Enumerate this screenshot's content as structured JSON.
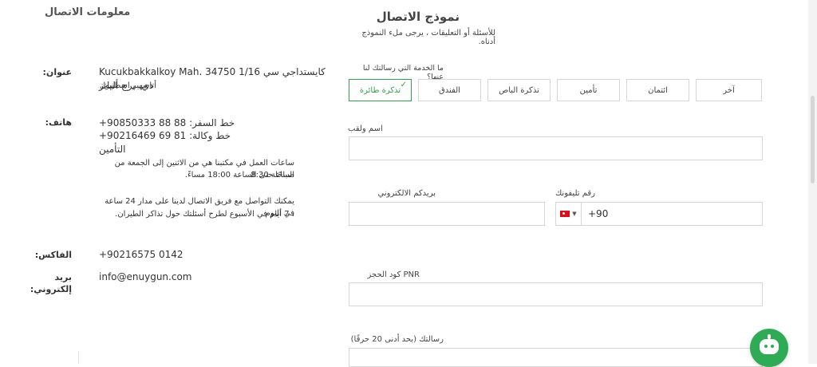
{
  "contact_info": {
    "title": "معلومات الاتصال",
    "address_label": "عنوان:",
    "address_line1": "Kucukbakkalkoy Mah. 34750 1/16 كايستداجي سي دي. برج أليانز",
    "address_line2": "أتاسهير اسطنبول",
    "phone_label": "هاتف:",
    "phone_line1": "+90850333 88 88   :خط السفر",
    "phone_line2": "+90216469 69 81   :خط وكالة التأمين",
    "hours_line1": "ساعات العمل في مكتبنا هي من الاثنين إلى الجمعة من الساعة 8:30",
    "hours_line2": "صباحًا حتى الساعة 18:00 مساءً.",
    "reach_line1": "يمكنك التواصل مع فريق الاتصال لدينا على مدار 24 ساعة في اليوم",
    "reach_line2": "، 7 أيام في الأسبوع لطرح أسئلتك حول تذاكر الطيران.",
    "fax_label": "الفاكس:",
    "fax_value": "+90216575 0142",
    "email_label_1": "بريد",
    "email_label_2": "إلكتروني:",
    "email_value": "info@enuygun.com"
  },
  "form": {
    "title": "نموذج الاتصال",
    "subtitle": "للأسئلة أو التعليقات ، يرجى ملء النموذج أدناه.",
    "service_question": "ما الخدمة التي رسالتك لنا عنها؟",
    "service_options": [
      "تذكرة طائرة",
      "الفندق",
      "تذكرة الباص",
      "تأمين",
      "ائتمان",
      "آخر"
    ],
    "selected_option": "تذكرة طائرة",
    "name_label": "اسم ولقب",
    "email_label": "بريدكم الالكتروني",
    "phone_label": "رقم تليفونك",
    "phone_code": "+90",
    "pnr_label": "PNR كود الحجز",
    "message_label": "رسالتك (بحد أدنى 20 حرفًا)"
  },
  "icons": {
    "check": "checkmark-icon",
    "flag": "turkey-flag-icon",
    "chatbot": "chatbot-icon"
  },
  "colors": {
    "accent": "#33a24d",
    "border": "#d7d7d7"
  }
}
